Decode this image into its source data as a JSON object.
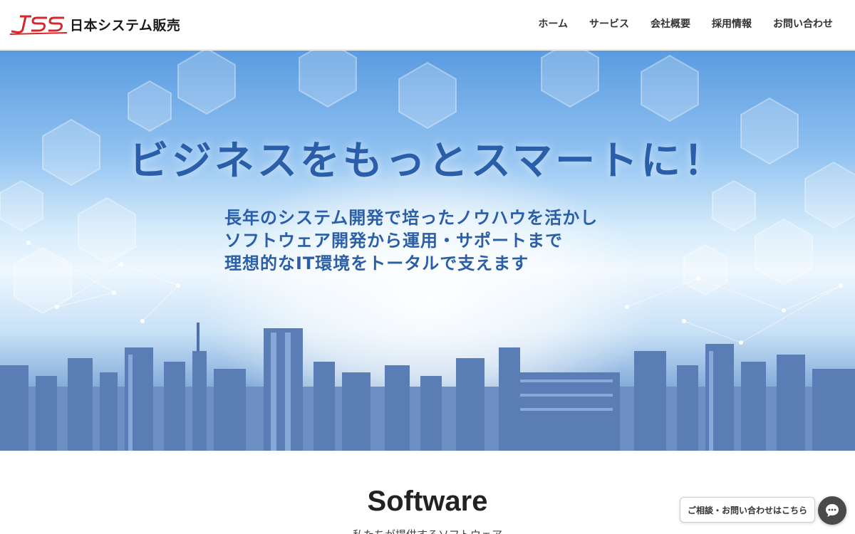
{
  "header": {
    "logo_text": "日本システム販売",
    "logo_mark": "JSS",
    "nav": [
      {
        "label": "ホーム"
      },
      {
        "label": "サービス"
      },
      {
        "label": "会社概要"
      },
      {
        "label": "採用情報"
      },
      {
        "label": "お問い合わせ"
      }
    ]
  },
  "hero": {
    "title": "ビジネスをもっとスマートに！",
    "lines": [
      "長年のシステム開発で培ったノウハウを活かし",
      "ソフトウェア開発から運用・サポートまで",
      "理想的なIT環境をトータルで支えます"
    ]
  },
  "section": {
    "title": "Software",
    "subtitle": "私たちが提供するソフトウェア"
  },
  "chat": {
    "label": "ご相談・お問い合わせはこちら",
    "icon": "chat-bubble-icon"
  },
  "colors": {
    "brand_red": "#d7262c",
    "hero_text": "#2a5ea8"
  }
}
